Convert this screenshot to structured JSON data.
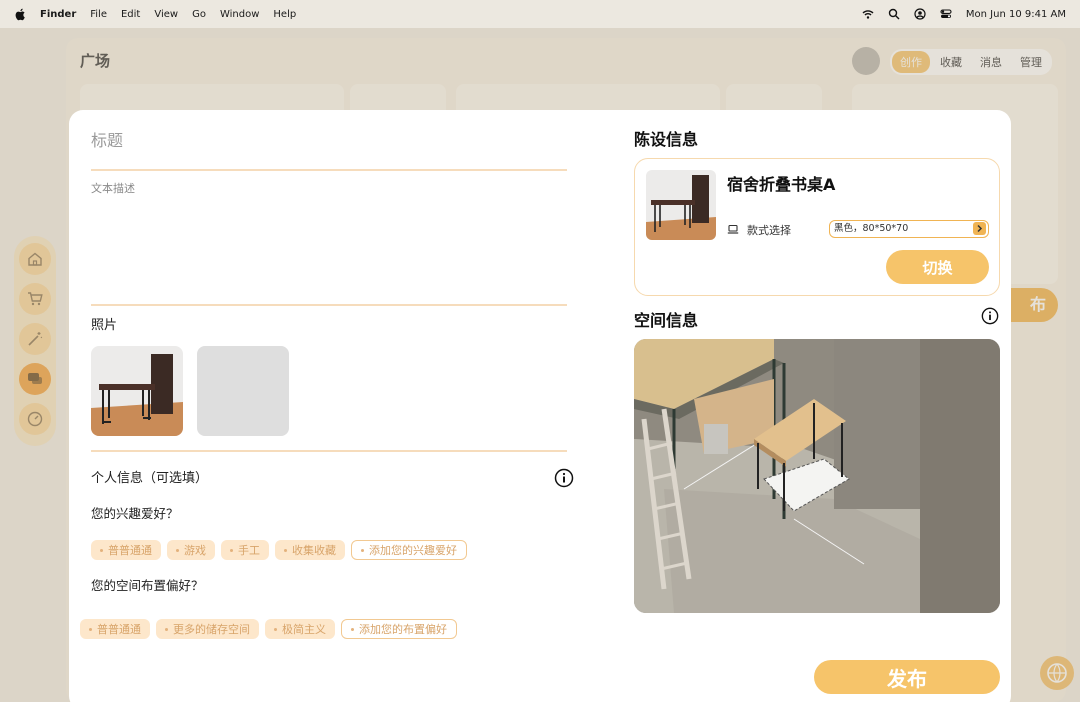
{
  "menubar": {
    "app": "Finder",
    "menus": [
      "File",
      "Edit",
      "View",
      "Go",
      "Window",
      "Help"
    ],
    "clock": "Mon Jun 10  9:41 AM",
    "icons": [
      "wifi-icon",
      "search-icon",
      "user-icon",
      "control-center-icon"
    ]
  },
  "background": {
    "title": "广场",
    "tabs": [
      "创作",
      "收藏",
      "消息",
      "管理"
    ],
    "active_tab": "创作",
    "partial_button_text": "布",
    "side_icons": [
      "home-icon",
      "cart-icon",
      "magic-wand-icon",
      "chat-icon",
      "compass-icon"
    ]
  },
  "form": {
    "title_placeholder": "标题",
    "description_placeholder": "文本描述",
    "photos_label": "照片",
    "personal_info_label": "个人信息（可选填）",
    "hobby_question": "您的兴趣爱好？",
    "hobby_chips": [
      "普普通通",
      "游戏",
      "手工",
      "收集收藏"
    ],
    "hobby_add": "添加您的兴趣爱好",
    "layout_question": "您的空间布置偏好？",
    "layout_chips": [
      "普普通通",
      "更多的储存空间",
      "极简主义"
    ],
    "layout_add": "添加您的布置偏好"
  },
  "furnishing": {
    "heading": "陈设信息",
    "item_name": "宿舍折叠书桌A",
    "style_label": "款式选择",
    "style_value": "黑色，80*50*70",
    "switch_button": "切换"
  },
  "space": {
    "heading": "空间信息"
  },
  "publish_button": "发布",
  "colors": {
    "accent": "#f6c46a",
    "chip_bg": "#fde7cb",
    "chip_text": "#d8a46a",
    "divider": "#f6dcbc"
  }
}
